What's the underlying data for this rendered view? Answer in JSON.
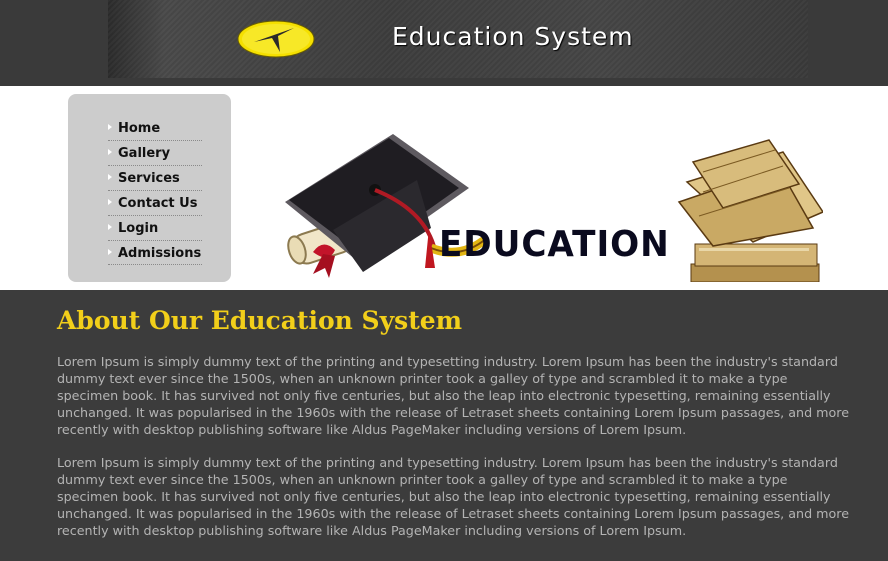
{
  "header": {
    "site_title": "Education System",
    "logo": {
      "icon": "yellow-oval-logo",
      "color": "#f5e000"
    }
  },
  "nav": {
    "items": [
      {
        "label": "Home"
      },
      {
        "label": "Gallery"
      },
      {
        "label": "Services"
      },
      {
        "label": "Contact Us"
      },
      {
        "label": "Login"
      },
      {
        "label": "Admissions"
      }
    ],
    "bullet_icon": "triangle-bullet-icon"
  },
  "hero": {
    "word": "EDUCATION",
    "icons": [
      "graduation-cap-icon",
      "diploma-scroll-icon",
      "book-stack-icon"
    ]
  },
  "main": {
    "title": "About Our Education System",
    "paragraphs": [
      "Lorem Ipsum is simply dummy text of the printing and typesetting industry. Lorem Ipsum has been the industry's standard dummy text ever since the 1500s, when an unknown printer took a galley of type and scrambled it to make a type specimen book. It has survived not only five centuries, but also the leap into electronic typesetting, remaining essentially unchanged. It was popularised in the 1960s with the release of Letraset sheets containing Lorem Ipsum passages, and more recently with desktop publishing software like Aldus PageMaker including versions of Lorem Ipsum.",
      "Lorem Ipsum is simply dummy text of the printing and typesetting industry. Lorem Ipsum has been the industry's standard dummy text ever since the 1500s, when an unknown printer took a galley of type and scrambled it to make a type specimen book. It has survived not only five centuries, but also the leap into electronic typesetting, remaining essentially unchanged. It was popularised in the 1960s with the release of Letraset sheets containing Lorem Ipsum passages, and more recently with desktop publishing software like Aldus PageMaker including versions of Lorem Ipsum."
    ]
  },
  "colors": {
    "background": "#3c3c3c",
    "title_accent": "#f2cf1a",
    "body_text": "#b4b4b4",
    "nav_panel": "#cccccc"
  }
}
